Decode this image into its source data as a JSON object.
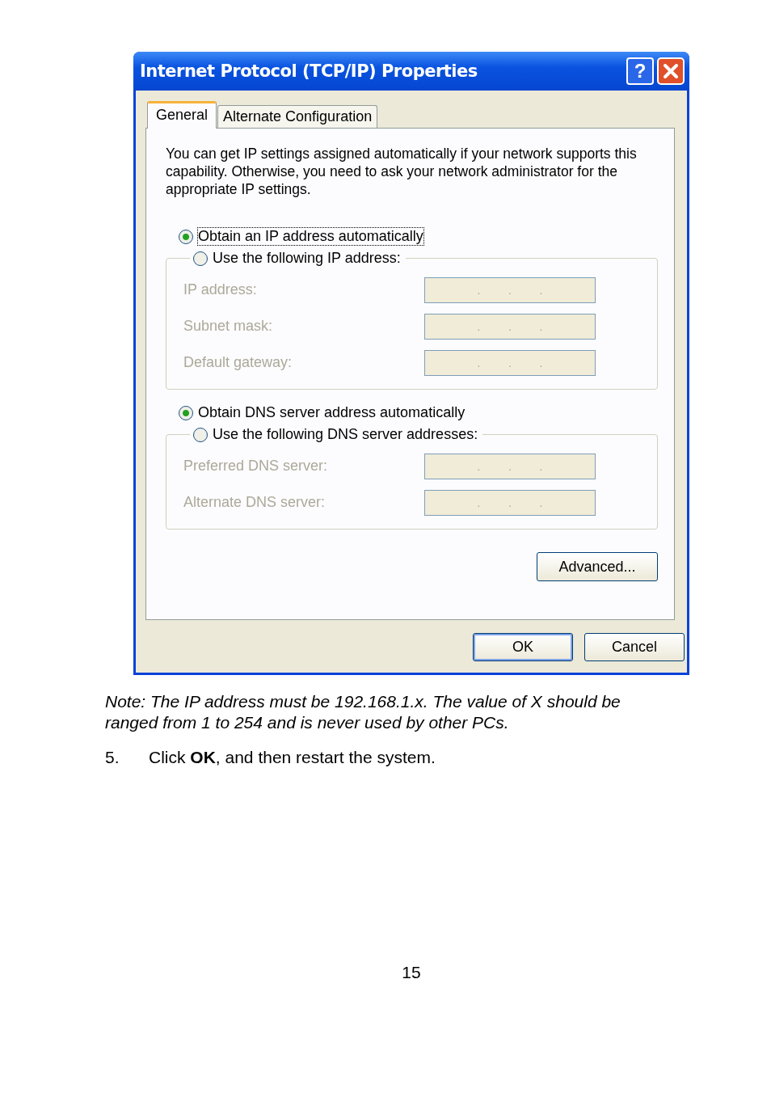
{
  "window": {
    "title": "Internet Protocol (TCP/IP) Properties",
    "help_button": "?"
  },
  "tabs": [
    {
      "label": "General",
      "selected": true
    },
    {
      "label": "Alternate Configuration",
      "selected": false
    }
  ],
  "description": "You can get IP settings assigned automatically if your network supports this capability. Otherwise, you need to ask your network administrator for the appropriate IP settings.",
  "ip_options": [
    {
      "label": "Obtain an IP address automatically",
      "selected": true
    },
    {
      "label": "Use the following IP address:",
      "selected": false
    }
  ],
  "ip_fields": [
    {
      "label": "IP address:",
      "disabled": true,
      "separators": [
        ".",
        ".",
        "."
      ]
    },
    {
      "label": "Subnet mask:",
      "disabled": true,
      "separators": [
        ".",
        ".",
        "."
      ]
    },
    {
      "label": "Default gateway:",
      "disabled": true,
      "separators": [
        ".",
        ".",
        "."
      ]
    }
  ],
  "dns_options": [
    {
      "label": "Obtain DNS server address automatically",
      "selected": true
    },
    {
      "label": "Use the following DNS server addresses:",
      "selected": false
    }
  ],
  "dns_fields": [
    {
      "label": "Preferred DNS server:",
      "disabled": true,
      "separators": [
        ".",
        ".",
        "."
      ]
    },
    {
      "label": "Alternate DNS server:",
      "disabled": true,
      "separators": [
        ".",
        ".",
        "."
      ]
    }
  ],
  "advanced_button": "Advanced...",
  "buttons": [
    "OK",
    "Cancel"
  ],
  "note": "Note: The IP address must be 192.168.1.x. The value of X should be ranged from 1 to 254 and is never used by other PCs.",
  "step": {
    "number": "5.",
    "text": "Click **OK**, and then restart the system."
  },
  "page_number": "15"
}
